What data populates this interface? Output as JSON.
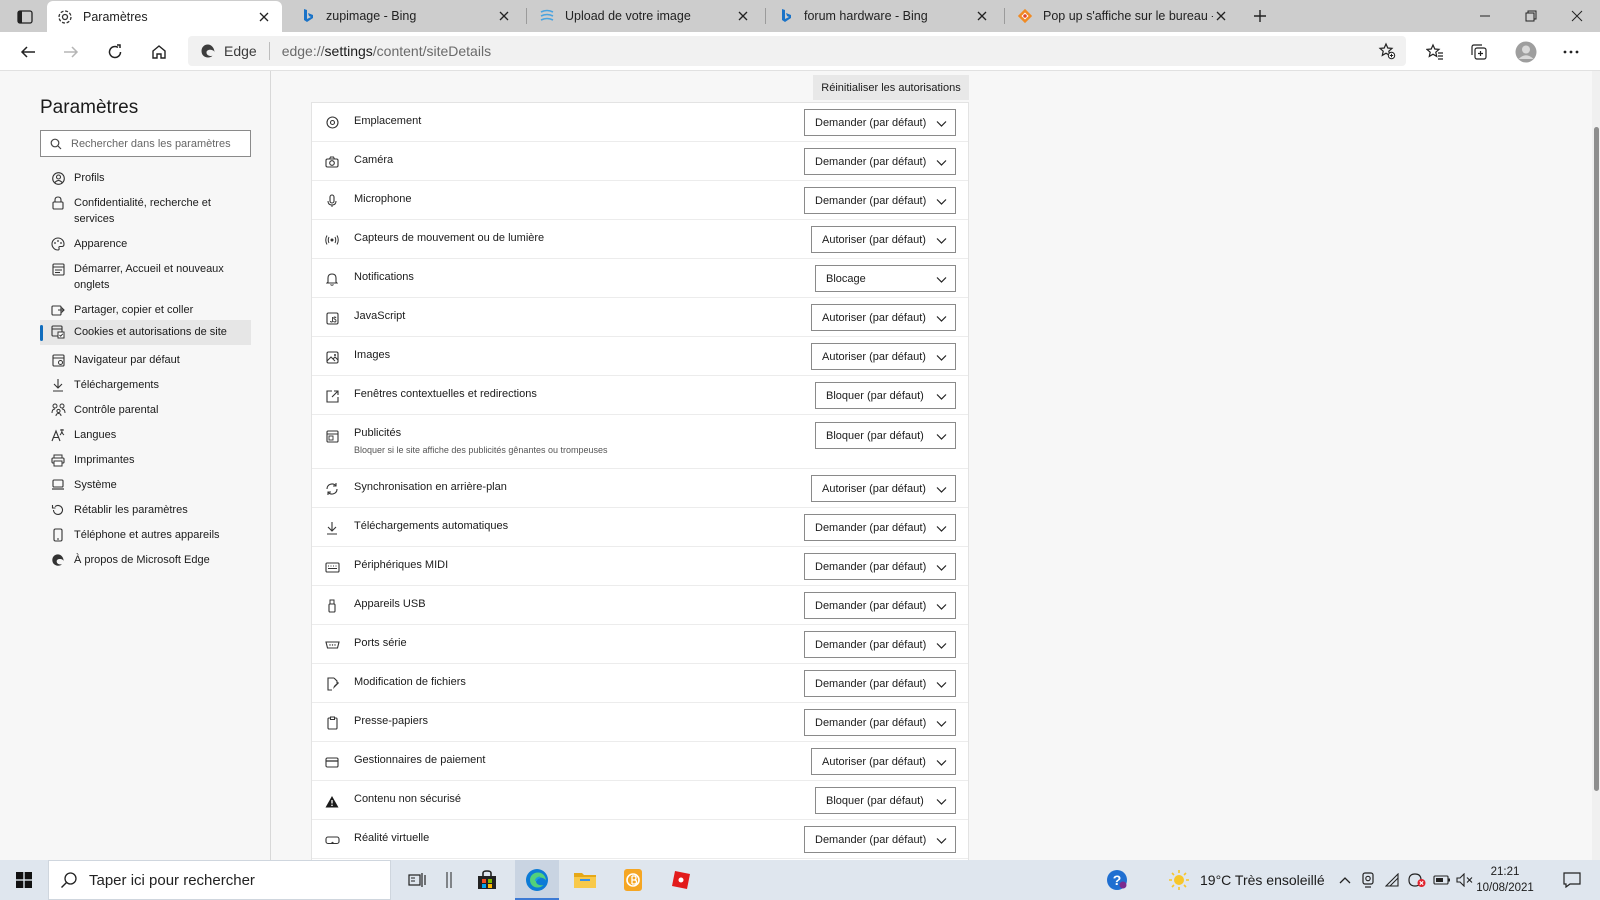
{
  "browser": {
    "tabs": [
      {
        "title": "Paramètres",
        "icon": "gear-icon",
        "active": true
      },
      {
        "title": "zupimage - Bing",
        "icon": "bing-icon",
        "active": false
      },
      {
        "title": "Upload de votre image",
        "icon": "zupimage-icon",
        "active": false
      },
      {
        "title": "forum hardware - Bing",
        "icon": "bing-icon",
        "active": false
      },
      {
        "title": "Pop up s'affiche sur le bureau - \\",
        "icon": "forum-icon",
        "active": false
      }
    ],
    "address": {
      "brand": "Edge",
      "url_prefix": "edge://",
      "url_host": "settings",
      "url_path": "/content/siteDetails"
    }
  },
  "sidebar": {
    "title": "Paramètres",
    "search_placeholder": "Rechercher dans les paramètres",
    "items": [
      {
        "label": "Profils",
        "icon": "profile-icon"
      },
      {
        "label": "Confidentialité, recherche et services",
        "icon": "lock-icon"
      },
      {
        "label": "Apparence",
        "icon": "appearance-icon"
      },
      {
        "label": "Démarrer, Accueil et nouveaux onglets",
        "icon": "home-tab-icon"
      },
      {
        "label": "Partager, copier et coller",
        "icon": "share-icon"
      },
      {
        "label": "Cookies et autorisations de site",
        "icon": "cookies-icon",
        "active": true
      },
      {
        "label": "Navigateur par défaut",
        "icon": "browser-icon"
      },
      {
        "label": "Téléchargements",
        "icon": "download-icon"
      },
      {
        "label": "Contrôle parental",
        "icon": "family-icon"
      },
      {
        "label": "Langues",
        "icon": "language-icon"
      },
      {
        "label": "Imprimantes",
        "icon": "printer-icon"
      },
      {
        "label": "Système",
        "icon": "laptop-icon"
      },
      {
        "label": "Rétablir les paramètres",
        "icon": "reset-icon"
      },
      {
        "label": "Téléphone et autres appareils",
        "icon": "phone-icon"
      },
      {
        "label": "À propos de Microsoft Edge",
        "icon": "edge-icon"
      }
    ]
  },
  "main": {
    "reset_button": "Réinitialiser les autorisations",
    "permissions": [
      {
        "label": "Emplacement",
        "value": "Demander (par défaut)",
        "icon": "location-icon"
      },
      {
        "label": "Caméra",
        "value": "Demander (par défaut)",
        "icon": "camera-icon"
      },
      {
        "label": "Microphone",
        "value": "Demander (par défaut)",
        "icon": "microphone-icon"
      },
      {
        "label": "Capteurs de mouvement ou de lumière",
        "value": "Autoriser (par défaut)",
        "icon": "sensor-icon"
      },
      {
        "label": "Notifications",
        "value": "Blocage",
        "icon": "bell-icon"
      },
      {
        "label": "JavaScript",
        "value": "Autoriser (par défaut)",
        "icon": "javascript-icon"
      },
      {
        "label": "Images",
        "value": "Autoriser (par défaut)",
        "icon": "image-icon"
      },
      {
        "label": "Fenêtres contextuelles et redirections",
        "value": "Bloquer (par défaut)",
        "icon": "popup-icon"
      },
      {
        "label": "Publicités",
        "description": "Bloquer si le site affiche des publicités gênantes ou trompeuses",
        "value": "Bloquer (par défaut)",
        "icon": "ads-icon"
      },
      {
        "label": "Synchronisation en arrière-plan",
        "value": "Autoriser (par défaut)",
        "icon": "sync-icon"
      },
      {
        "label": "Téléchargements automatiques",
        "value": "Demander (par défaut)",
        "icon": "download-icon"
      },
      {
        "label": "Périphériques MIDI",
        "value": "Demander (par défaut)",
        "icon": "midi-icon"
      },
      {
        "label": "Appareils USB",
        "value": "Demander (par défaut)",
        "icon": "usb-icon"
      },
      {
        "label": "Ports série",
        "value": "Demander (par défaut)",
        "icon": "serial-port-icon"
      },
      {
        "label": "Modification de fichiers",
        "value": "Demander (par défaut)",
        "icon": "file-edit-icon"
      },
      {
        "label": "Presse-papiers",
        "value": "Demander (par défaut)",
        "icon": "clipboard-icon"
      },
      {
        "label": "Gestionnaires de paiement",
        "value": "Autoriser (par défaut)",
        "icon": "payment-icon"
      },
      {
        "label": "Contenu non sécurisé",
        "value": "Bloquer (par défaut)",
        "icon": "warning-icon"
      },
      {
        "label": "Réalité virtuelle",
        "value": "Demander (par défaut)",
        "icon": "vr-icon"
      }
    ]
  },
  "taskbar": {
    "search_placeholder": "Taper ici pour rechercher",
    "weather": "19°C  Très ensoleillé",
    "time": "21:21",
    "date": "10/08/2021"
  },
  "colors": {
    "accent": "#0f6cbd",
    "tab_bar": "#cdcdcd",
    "taskbar": "#dfe6ee"
  }
}
